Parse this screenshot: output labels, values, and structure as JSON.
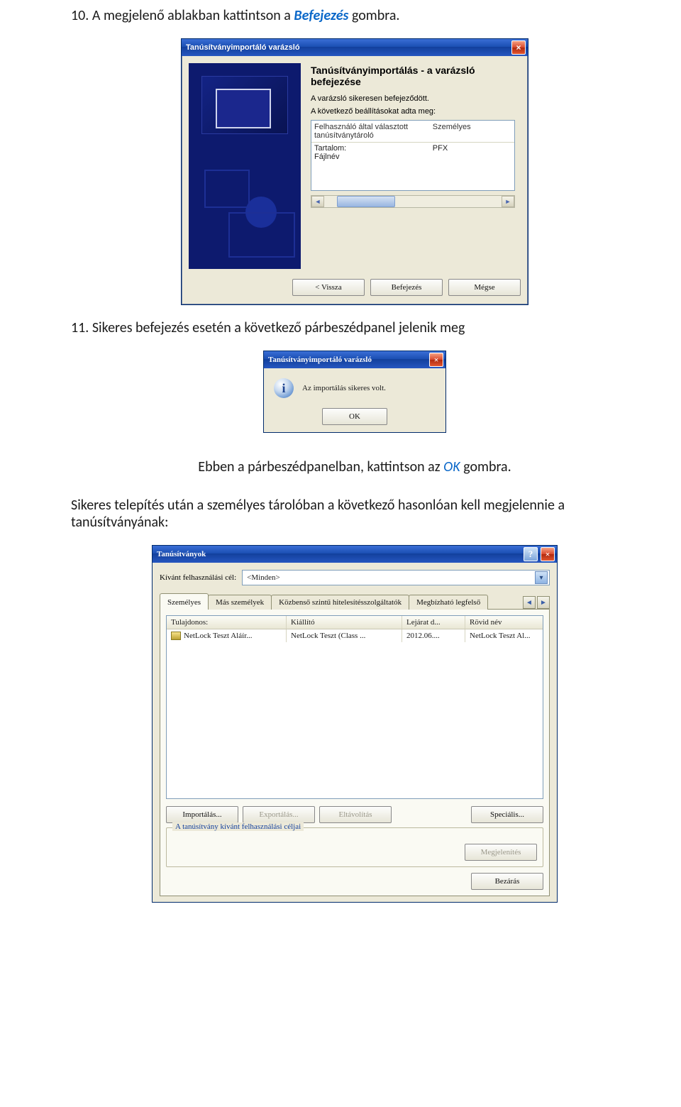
{
  "doc": {
    "step10_num": "10.",
    "step10_text": "A megjelenő ablakban kattintson a ",
    "step10_em": "Befejezés",
    "step10_end": " gombra.",
    "step11_num": "11.",
    "step11_text": "Sikeres befejezés esetén a következő párbeszédpanel jelenik meg",
    "mid_pre": "Ebben a párbeszédpanelban, kattintson az ",
    "mid_em": "OK",
    "mid_post": " gombra.",
    "after_text": "Sikeres telepítés után a személyes tárolóban a következő hasonlóan kell megjelennie a tanúsítványának:"
  },
  "wiz": {
    "title": "Tanúsítványimportáló varázsló",
    "heading": "Tanúsítványimportálás - a varázsló befejezése",
    "done": "A varázsló sikeresen befejeződött.",
    "settings_label": "A következő beállításokat adta meg:",
    "cols": {
      "c1": "Felhasználó által választott tanúsítványtároló",
      "c2": "Személyes"
    },
    "rows": [
      {
        "c1": "Tartalom:",
        "c2": "PFX"
      },
      {
        "c1": "Fájlnév",
        "c2": ""
      }
    ],
    "btn_back": "< Vissza",
    "btn_finish": "Befejezés",
    "btn_cancel": "Mégse"
  },
  "info": {
    "title": "Tanúsítványimportáló varázsló",
    "msg": "Az importálás sikeres volt.",
    "ok": "OK"
  },
  "cert": {
    "title": "Tanúsítványok",
    "purpose_label": "Kívánt felhasználási cél:",
    "purpose_value": "<Minden>",
    "tabs": [
      "Személyes",
      "Más személyek",
      "Közbenső szintű hitelesítésszolgáltatók",
      "Megbízható legfelső"
    ],
    "columns": {
      "owner": "Tulajdonos:",
      "issuer": "Kiállító",
      "expiry": "Lejárat d...",
      "short": "Rövid név"
    },
    "row": {
      "owner": "NetLock Teszt Aláír...",
      "issuer": "NetLock Teszt (Class ...",
      "expiry": "2012.06....",
      "short": "NetLock Teszt Al..."
    },
    "btn_import": "Importálás...",
    "btn_export": "Exportálás...",
    "btn_remove": "Eltávolítás",
    "btn_advanced": "Speciális...",
    "group_legend": "A tanúsítvány kívánt felhasználási céljai",
    "btn_view": "Megjelenítés",
    "btn_close": "Bezárás"
  }
}
